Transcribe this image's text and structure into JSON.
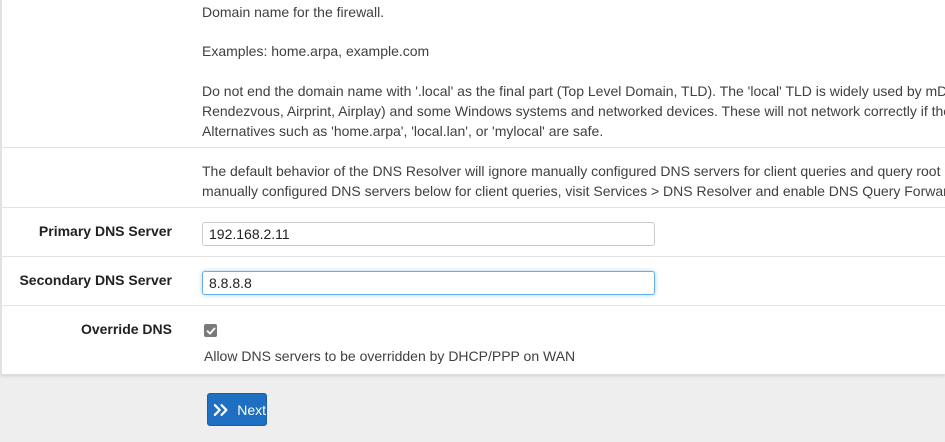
{
  "domain_help": {
    "line1": "Domain name for the firewall.",
    "line2": "Examples: home.arpa, example.com",
    "line3": "Do not end the domain name with '.local' as the final part (Top Level Domain, TLD). The 'local' TLD is widely used by mDN",
    "line4": "Rendezvous, Airprint, Airplay) and some Windows systems and networked devices. These will not network correctly if the",
    "line5": "Alternatives such as 'home.arpa', 'local.lan', or 'mylocal' are safe."
  },
  "resolver_help": {
    "line1": "The default behavior of the DNS Resolver will ignore manually configured DNS servers for client queries and query root D",
    "line2": "manually configured DNS servers below for client queries, visit Services > DNS Resolver and enable DNS Query Forwardi"
  },
  "primary_dns": {
    "label": "Primary DNS Server",
    "value": "192.168.2.11"
  },
  "secondary_dns": {
    "label": "Secondary DNS Server",
    "value": "8.8.8.8"
  },
  "override_dns": {
    "label": "Override DNS",
    "checked": true,
    "description": "Allow DNS servers to be overridden by DHCP/PPP on WAN"
  },
  "next_button": {
    "label": "Next",
    "icon": "double-chevron-right-icon"
  },
  "colors": {
    "button_primary": "#1e6fc1",
    "focus_border": "#66afe9"
  }
}
